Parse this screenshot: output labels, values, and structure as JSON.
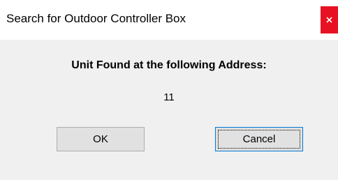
{
  "window": {
    "title": "Search for Outdoor Controller Box",
    "close_glyph": "x",
    "close_color": "#e81123"
  },
  "dialog": {
    "heading": "Unit Found at the following Address:",
    "address_value": "11"
  },
  "buttons": {
    "ok_label": "OK",
    "cancel_label": "Cancel"
  }
}
